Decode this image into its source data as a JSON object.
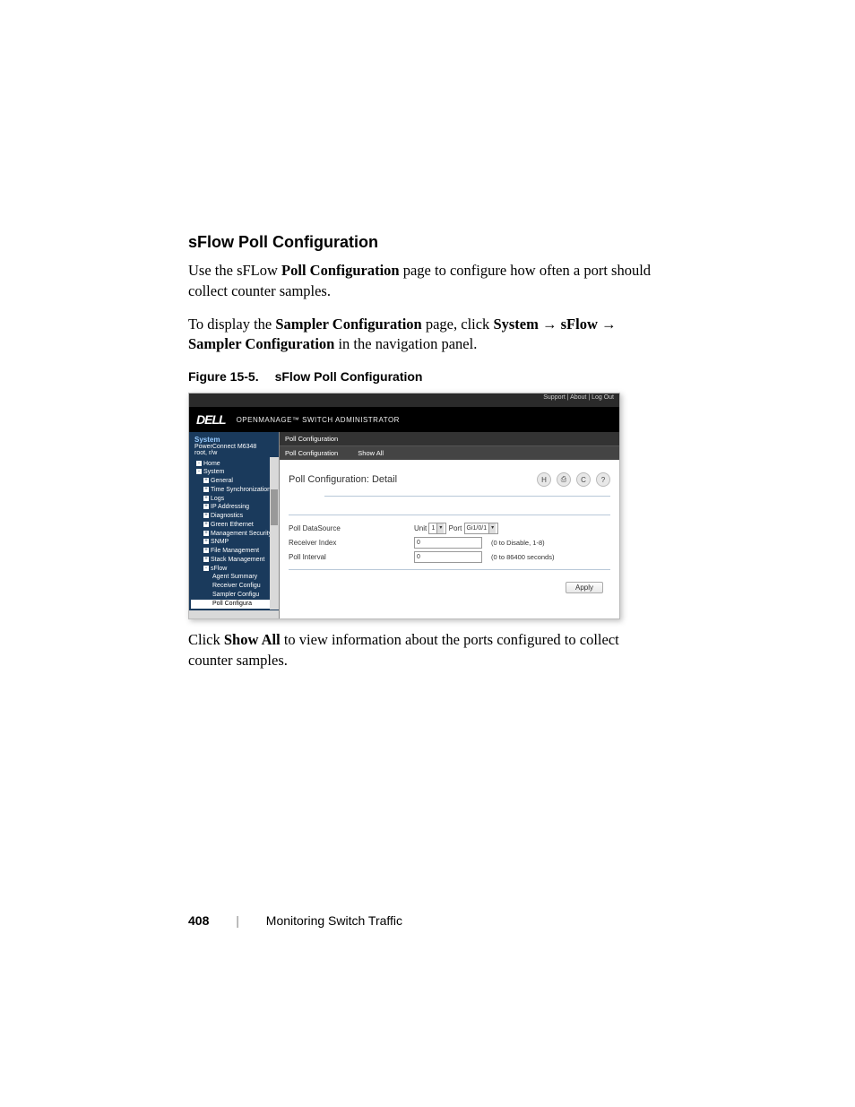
{
  "heading": "sFlow Poll Configuration",
  "para1_a": "Use the sFLow ",
  "para1_bold": "Poll Configuration",
  "para1_b": " page to configure how often a port should collect counter samples.",
  "para2_a": "To display the ",
  "para2_bold1": "Sampler Configuration",
  "para2_b": " page, click ",
  "para2_bold2": "System",
  "arrow": " → ",
  "para2_bold3": "sFlow",
  "para2_bold4": "Sampler Configuration",
  "para2_c": " in the navigation panel.",
  "fig_num": "Figure 15-5.",
  "fig_title": "sFlow Poll Configuration",
  "screenshot": {
    "toplinks": "Support  |  About  |  Log Out",
    "logo": "DELL",
    "title": "OPENMANAGE™ SWITCH ADMINISTRATOR",
    "nav": {
      "system_label": "System",
      "device": "PowerConnect M6348",
      "user": "root, r/w",
      "items": [
        "Home",
        "System",
        "General",
        "Time Synchronization",
        "Logs",
        "IP Addressing",
        "Diagnostics",
        "Green Ethernet",
        "Management Security",
        "SNMP",
        "File Management",
        "Stack Management",
        "sFlow",
        "Agent Summary",
        "Receiver Configu",
        "Sampler Configu",
        "Poll Configura"
      ]
    },
    "main": {
      "crumb": "Poll Configuration",
      "tab1": "Poll Configuration",
      "tab2": "Show All",
      "panel_title": "Poll Configuration: Detail",
      "rows": {
        "datasource_label": "Poll DataSource",
        "datasource_unit_label": "Unit",
        "datasource_unit_value": "1",
        "datasource_port_label": "Port",
        "datasource_port_value": "Gi1/0/1",
        "recv_label": "Receiver Index",
        "recv_value": "0",
        "recv_hint": "(0 to Disable, 1-8)",
        "interval_label": "Poll Interval",
        "interval_value": "0",
        "interval_hint": "(0 to 86400 seconds)"
      },
      "apply": "Apply"
    }
  },
  "para3_a": "Click ",
  "para3_bold": "Show All",
  "para3_b": " to view information about the ports configured to collect counter samples.",
  "footer": {
    "num": "408",
    "sep": "|",
    "title": "Monitoring Switch Traffic"
  }
}
